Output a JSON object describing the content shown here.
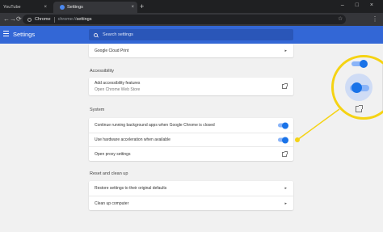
{
  "browser": {
    "tabs": [
      {
        "label": "YouTube",
        "close": "×"
      },
      {
        "label": "Settings",
        "close": "×"
      }
    ],
    "new_tab": "+",
    "window_controls": "– □ ×",
    "nav": {
      "back": "←",
      "forward": "→",
      "reload": "⟳"
    },
    "omnibox": {
      "site": "Chrome",
      "url_prefix": "chrome://",
      "url_path": "settings"
    },
    "star": "☆",
    "menu": "⋮"
  },
  "header": {
    "title": "Settings",
    "search_placeholder": "Search settings"
  },
  "sections": {
    "top_card": {
      "items": [
        {
          "label": "Google Cloud Print",
          "arrow": "▸"
        }
      ]
    },
    "accessibility": {
      "title": "Accessibility",
      "items": [
        {
          "label": "Add accessibility features",
          "sublabel": "Open Chrome Web Store"
        }
      ]
    },
    "system": {
      "title": "System",
      "items": [
        {
          "label": "Continue running background apps when Google Chrome is closed",
          "enabled": true
        },
        {
          "label": "Use hardware acceleration when available",
          "enabled": true
        },
        {
          "label": "Open proxy settings"
        }
      ]
    },
    "reset": {
      "title": "Reset and clean up",
      "items": [
        {
          "label": "Restore settings to their original defaults",
          "arrow": "▸"
        },
        {
          "label": "Clean up computer",
          "arrow": "▸"
        }
      ]
    }
  },
  "colors": {
    "header_blue": "#3367d6",
    "toggle_blue": "#1a73e8",
    "callout_yellow": "#f5d313"
  }
}
